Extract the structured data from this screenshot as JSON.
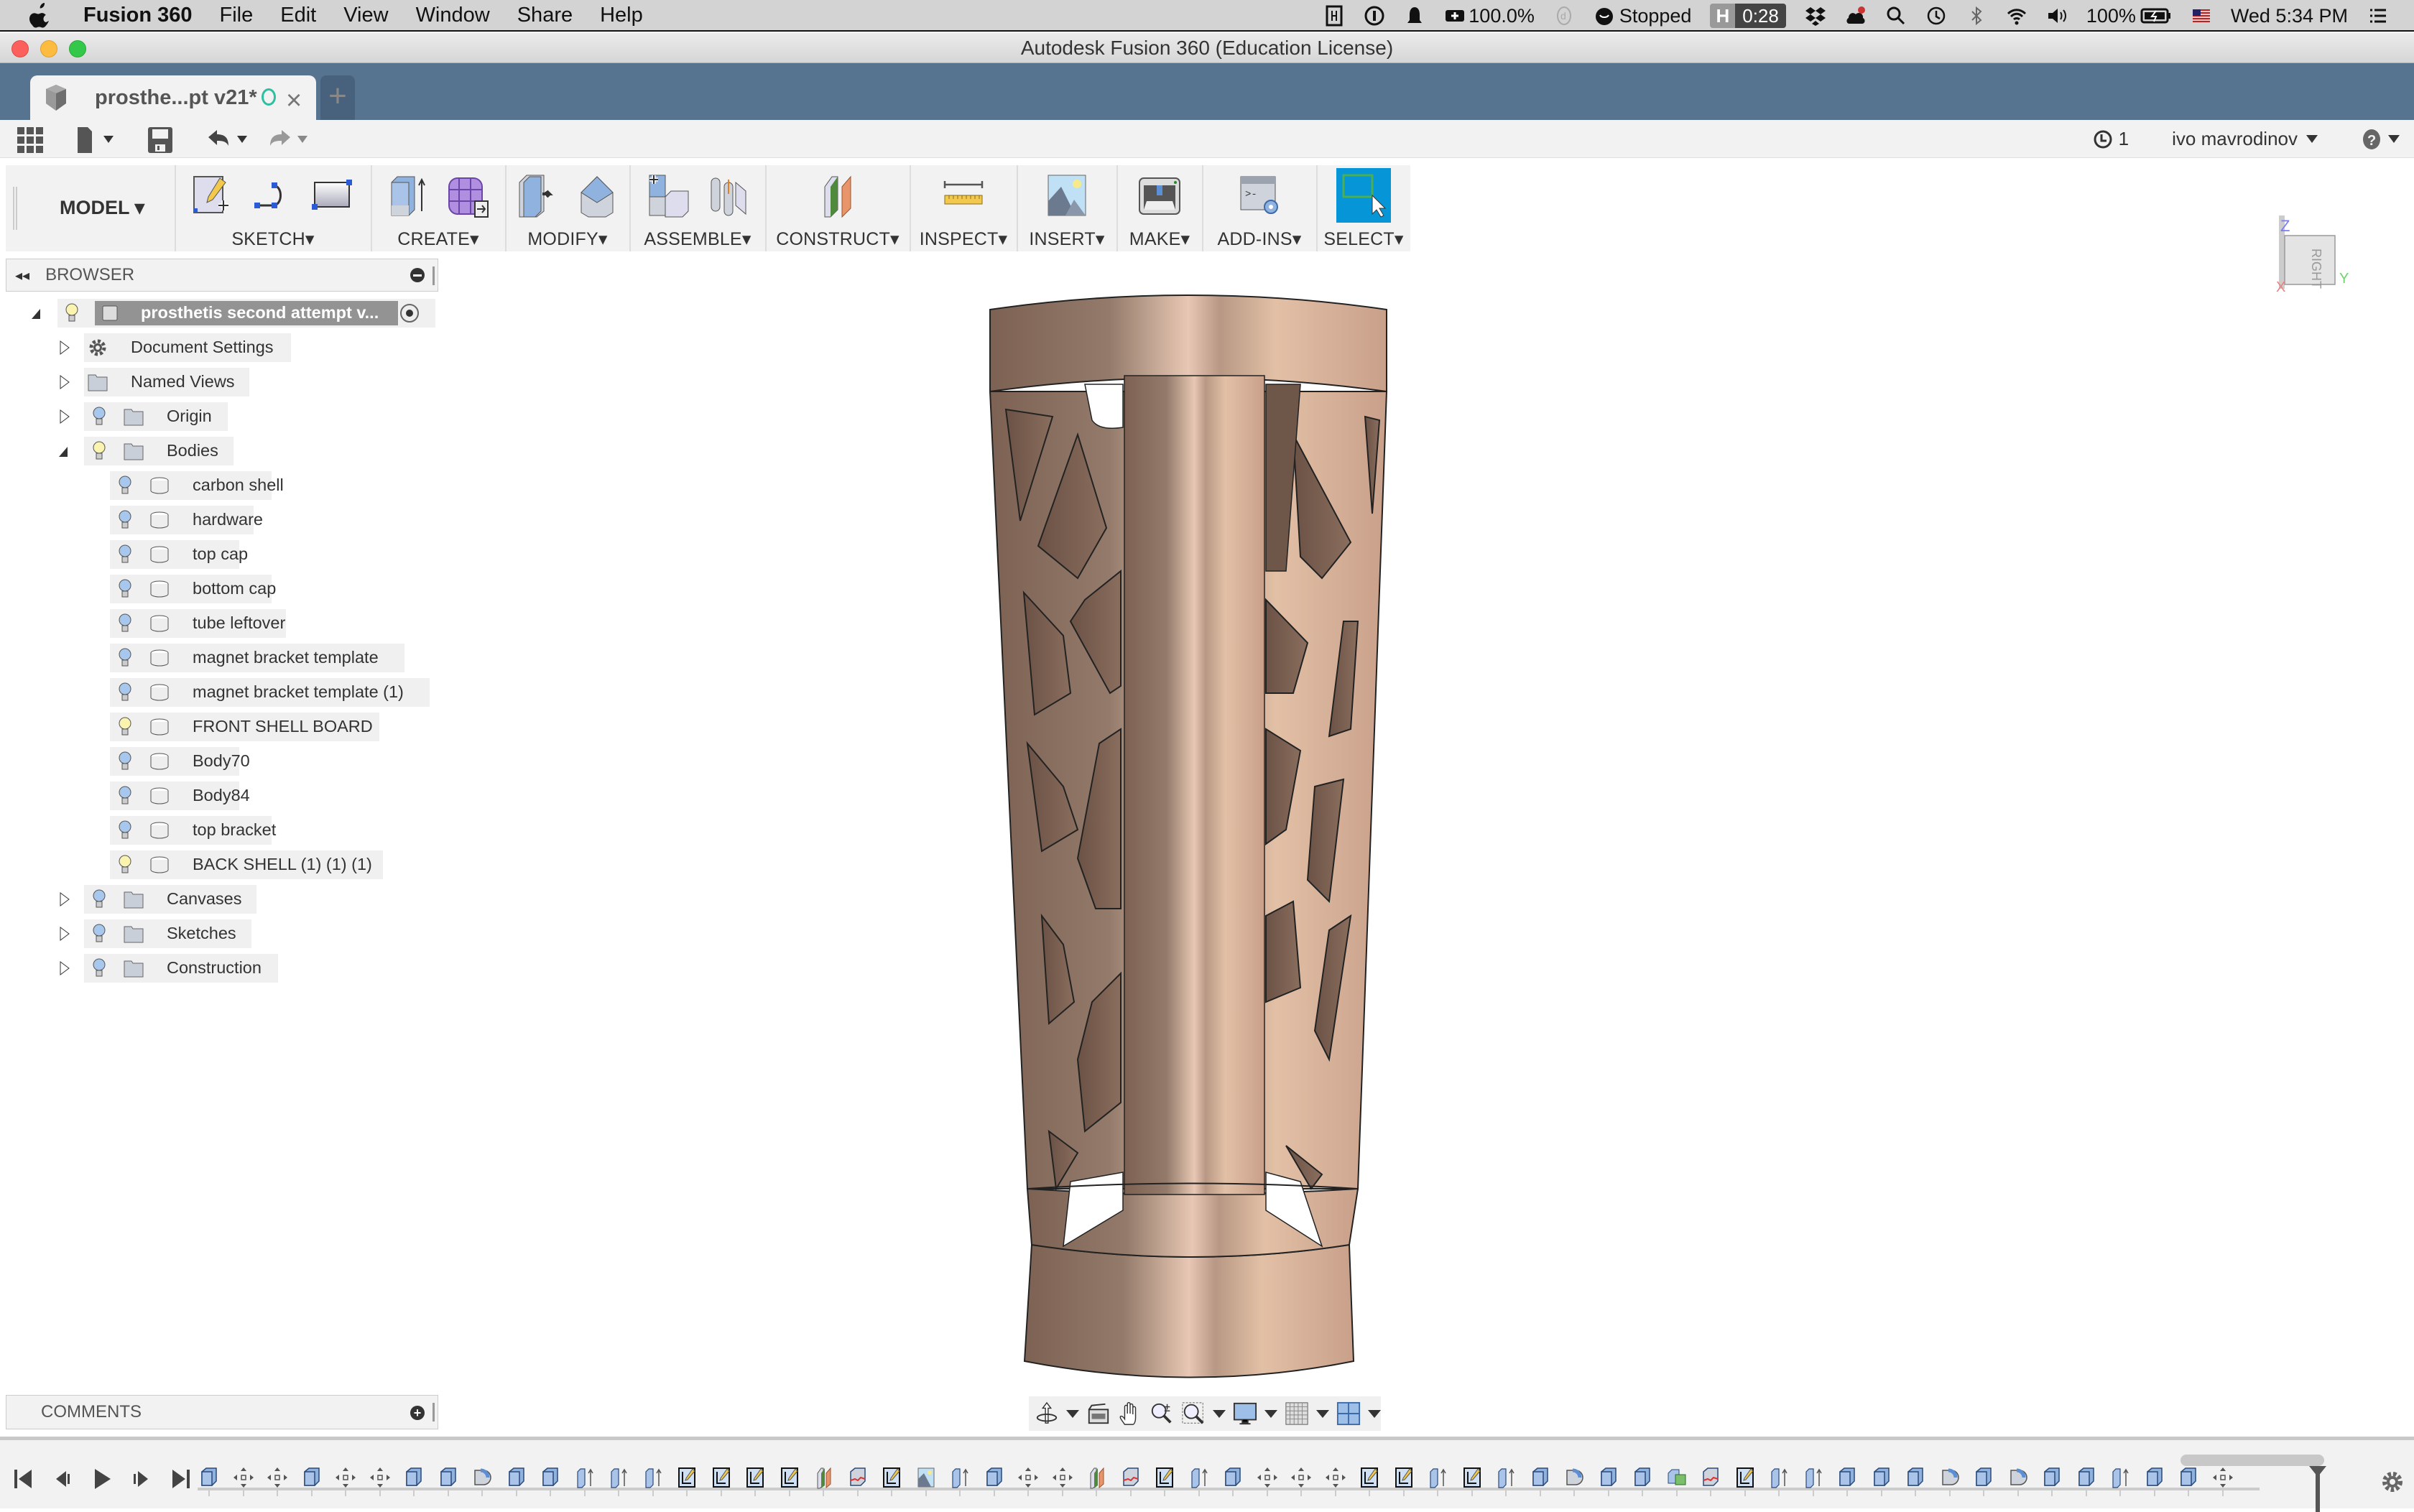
{
  "menubar": {
    "app_name": "Fusion 360",
    "items": [
      "File",
      "Edit",
      "View",
      "Window",
      "Share",
      "Help"
    ],
    "status": {
      "battery_app": "100.0%",
      "timer_state": "Stopped",
      "h_badge": "H",
      "h_time": "0:28",
      "battery": "100%",
      "clock": "Wed 5:34 PM"
    }
  },
  "window": {
    "title": "Autodesk Fusion 360 (Education License)"
  },
  "tabs": {
    "active": "prosthe...pt v21*",
    "new_tab": "+"
  },
  "quickbar": {
    "jobs_count": "1",
    "user": "ivo mavrodinov"
  },
  "ribbon": {
    "workspace": "MODEL",
    "groups": [
      "SKETCH",
      "CREATE",
      "MODIFY",
      "ASSEMBLE",
      "CONSTRUCT",
      "INSPECT",
      "INSERT",
      "MAKE",
      "ADD-INS",
      "SELECT"
    ]
  },
  "browser": {
    "title": "BROWSER",
    "root": "prosthetis second attempt v...",
    "items": [
      {
        "label": "Document Settings"
      },
      {
        "label": "Named Views"
      },
      {
        "label": "Origin"
      },
      {
        "label": "Bodies"
      },
      {
        "label": "Canvases"
      },
      {
        "label": "Sketches"
      },
      {
        "label": "Construction"
      }
    ],
    "bodies": [
      {
        "label": "carbon shell",
        "bulb": "blue"
      },
      {
        "label": "hardware",
        "bulb": "blue"
      },
      {
        "label": "top cap",
        "bulb": "blue"
      },
      {
        "label": "bottom cap",
        "bulb": "blue"
      },
      {
        "label": "tube leftover",
        "bulb": "blue"
      },
      {
        "label": "magnet bracket template",
        "bulb": "blue"
      },
      {
        "label": "magnet bracket template (1)",
        "bulb": "blue"
      },
      {
        "label": "FRONT SHELL BOARD",
        "bulb": "yellow"
      },
      {
        "label": "Body70",
        "bulb": "blue"
      },
      {
        "label": "Body84",
        "bulb": "blue"
      },
      {
        "label": "top bracket",
        "bulb": "blue"
      },
      {
        "label": "BACK SHELL (1) (1) (1)",
        "bulb": "yellow"
      }
    ]
  },
  "comments": {
    "title": "COMMENTS"
  },
  "viewcube": {
    "face": "RIGHT",
    "axis_z": "Z",
    "axis_y": "Y",
    "axis_x": "X"
  },
  "colors": {
    "tab_bar": "#56738f",
    "select_active": "#0696d7",
    "model_copper": "#c9a08a"
  },
  "timeline": {
    "features": [
      "extrude",
      "move",
      "move",
      "extrude",
      "move",
      "move",
      "extrude",
      "extrude",
      "revolve",
      "extrude",
      "extrude",
      "press-pull",
      "press-pull",
      "press-pull",
      "sketch",
      "sketch",
      "sketch",
      "sketch",
      "plane",
      "split",
      "sketch",
      "canvas",
      "press-pull",
      "extrude",
      "move",
      "move",
      "plane",
      "split",
      "sketch",
      "press-pull",
      "extrude",
      "move",
      "move",
      "move",
      "sketch",
      "sketch",
      "press-pull",
      "sketch",
      "press-pull",
      "extrude",
      "revolve",
      "extrude",
      "extrude",
      "combine",
      "split",
      "sketch",
      "press-pull",
      "press-pull",
      "extrude",
      "extrude",
      "extrude",
      "revolve",
      "extrude",
      "revolve",
      "extrude",
      "extrude",
      "press-pull",
      "extrude",
      "extrude",
      "move"
    ]
  }
}
